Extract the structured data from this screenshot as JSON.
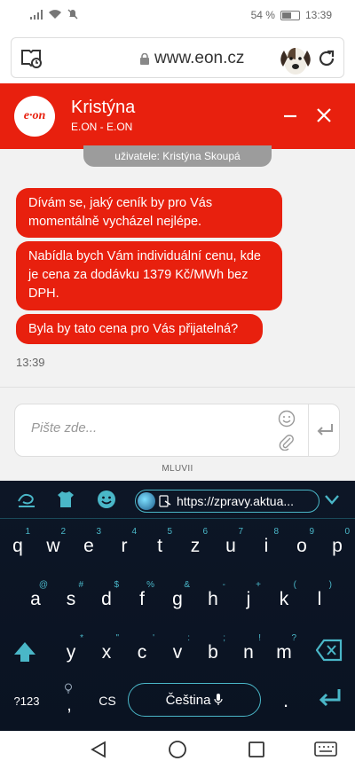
{
  "status_bar": {
    "battery": "54 %",
    "time": "13:39"
  },
  "browser": {
    "url": "www.eon.cz"
  },
  "chat_header": {
    "logo": "e·on",
    "agent_name": "Kristýna",
    "agent_org": "E.ON - E.ON",
    "accent": "#e8200e"
  },
  "chat": {
    "system_notice": "uživatele: Kristýna Skoupá",
    "messages": [
      "Dívám se, jaký ceník by pro Vás momentálně vycházel nejlépe.",
      "Nabídla bych Vám individuální cenu, kde je cena za dodávku 1379 Kč/MWh bez DPH.",
      "Byla by tato cena pro Vás přijatelná?"
    ],
    "time": "13:39"
  },
  "input": {
    "placeholder": "Pište zde...",
    "footer": "MLUVII"
  },
  "keyboard": {
    "url_chip": "https://zpravy.aktua...",
    "row1": [
      {
        "k": "q",
        "h": "1"
      },
      {
        "k": "w",
        "h": "2"
      },
      {
        "k": "e",
        "h": "3"
      },
      {
        "k": "r",
        "h": "4"
      },
      {
        "k": "t",
        "h": "5"
      },
      {
        "k": "z",
        "h": "6"
      },
      {
        "k": "u",
        "h": "7"
      },
      {
        "k": "i",
        "h": "8"
      },
      {
        "k": "o",
        "h": "9"
      },
      {
        "k": "p",
        "h": "0"
      }
    ],
    "row2": [
      {
        "k": "a",
        "h": "@"
      },
      {
        "k": "s",
        "h": "#"
      },
      {
        "k": "d",
        "h": "$"
      },
      {
        "k": "f",
        "h": "%"
      },
      {
        "k": "g",
        "h": "&"
      },
      {
        "k": "h",
        "h": "-"
      },
      {
        "k": "j",
        "h": "+"
      },
      {
        "k": "k",
        "h": "("
      },
      {
        "k": "l",
        "h": ")"
      }
    ],
    "row3": [
      {
        "k": "y",
        "h": "*"
      },
      {
        "k": "x",
        "h": "\""
      },
      {
        "k": "c",
        "h": "'"
      },
      {
        "k": "v",
        "h": ":"
      },
      {
        "k": "b",
        "h": ";"
      },
      {
        "k": "n",
        "h": "!"
      },
      {
        "k": "m",
        "h": "?"
      }
    ],
    "num_key": "?123",
    "comma_key": ",",
    "lang_key": "CS",
    "space_label": "Čeština",
    "period_key": "."
  }
}
